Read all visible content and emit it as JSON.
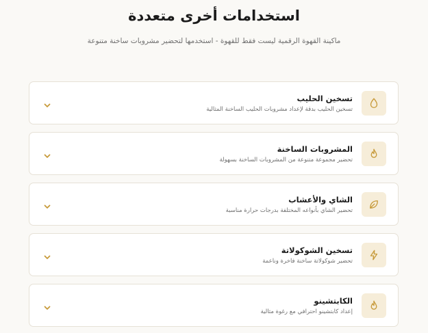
{
  "header": {
    "title": "استخدامات أخرى متعددة",
    "subtitle": "ماكينة القهوة الرقمية ليست فقط للقهوة - استخدمها لتحضير مشروبات ساخنة متنوعة"
  },
  "uses": [
    {
      "title": "تسخين الحليب",
      "description": "تسخين الحليب بدقة لإعداد مشروبات الحليب الساخنة المثالية",
      "icon": "droplet-icon"
    },
    {
      "title": "المشروبات الساخنة",
      "description": "تحضير مجموعة متنوعة من المشروبات الساخنة بسهولة",
      "icon": "flame-icon"
    },
    {
      "title": "الشاي والأعشاب",
      "description": "تحضير الشاي بأنواعه المختلفة بدرجات حرارة مناسبة",
      "icon": "leaf-icon"
    },
    {
      "title": "تسخين الشوكولاتة",
      "description": "تحضير شوكولاتة ساخنة فاخرة وناعمة",
      "icon": "lightning-icon"
    },
    {
      "title": "الكابتشينو",
      "description": "إعداد كابتشينو احترافي مع رغوة مثالية",
      "icon": "flame-icon"
    }
  ],
  "colors": {
    "accent": "#c79a3a",
    "icon_background": "#f6edd9",
    "page_background": "#faf9f6",
    "card_border": "#e6e1d6"
  }
}
